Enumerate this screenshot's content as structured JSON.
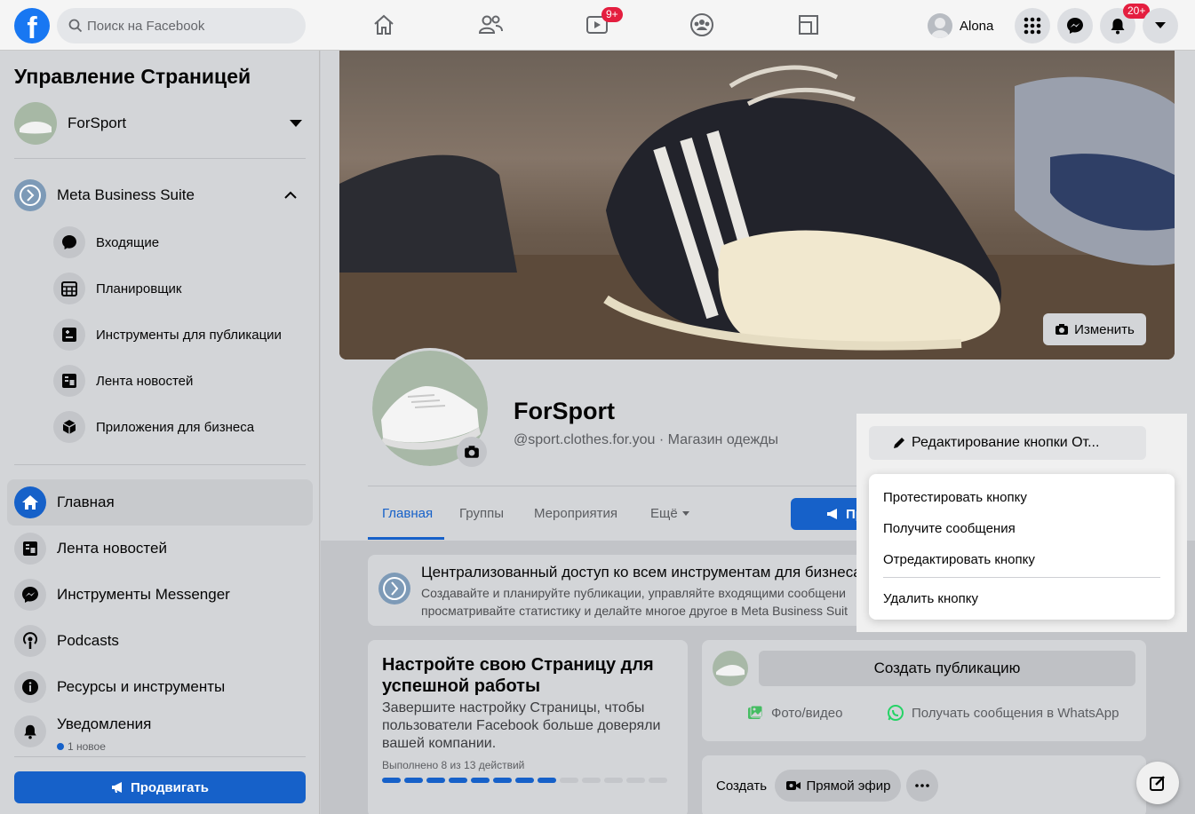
{
  "topbar": {
    "logo_letter": "f",
    "search_placeholder": "Поиск на Facebook",
    "watch_badge": "9+",
    "user_name": "Alona",
    "notifications_badge": "20+"
  },
  "sidebar": {
    "title": "Управление Страницей",
    "page_name": "ForSport",
    "meta_business_suite": "Meta Business Suite",
    "sub_items": [
      {
        "label": "Входящие",
        "icon": "message-icon"
      },
      {
        "label": "Планировщик",
        "icon": "calendar-icon"
      },
      {
        "label": "Инструменты для публикации",
        "icon": "publishing-tools-icon"
      },
      {
        "label": "Лента новостей",
        "icon": "news-feed-icon"
      },
      {
        "label": "Приложения для бизнеса",
        "icon": "apps-icon"
      }
    ],
    "main_items": [
      {
        "label": "Главная",
        "icon": "home-icon"
      },
      {
        "label": "Лента новостей",
        "icon": "news-feed-icon"
      },
      {
        "label": "Инструменты Messenger",
        "icon": "messenger-icon"
      },
      {
        "label": "Podcasts",
        "icon": "podcast-icon"
      },
      {
        "label": "Ресурсы и инструменты",
        "icon": "info-icon"
      },
      {
        "label": "Уведомления",
        "icon": "bell-icon"
      }
    ],
    "notifications_sub": "1 новое",
    "promote_button": "Продвигать"
  },
  "profile": {
    "edit_cover": "Изменить",
    "name": "ForSport",
    "handle": "@sport.clothes.for.you · Магазин одежды",
    "tabs": [
      "Главная",
      "Группы",
      "Мероприятия",
      "Ещё"
    ],
    "promote_button": "Про"
  },
  "popup": {
    "edit_button": "Редактирование кнопки От...",
    "items": [
      "Протестировать кнопку",
      "Получите сообщения",
      "Отредактировать кнопку"
    ],
    "delete": "Удалить кнопку"
  },
  "mbs_card": {
    "title": "Централизованный доступ ко всем инструментам для бизнеса",
    "line1": "Создавайте и планируйте публикации, управляйте входящими сообщени",
    "line2": "просматривайте статистику и делайте многое другое в Meta Business Suit"
  },
  "setup_card": {
    "title": "Настройте свою Страницу для успешной работы",
    "text": "Завершите настройку Страницы, чтобы пользователи Facebook больше доверяли вашей компании.",
    "progress_text": "Выполнено 8 из 13 действий",
    "steps_done": 8,
    "steps_total": 13
  },
  "create_card": {
    "button": "Создать публикацию",
    "photo_video": "Фото/видео",
    "whatsapp": "Получать сообщения в WhatsApp"
  },
  "live_card": {
    "label": "Создать",
    "live": "Прямой эфир"
  },
  "colors": {
    "accent": "#1661c9",
    "badge": "#e41e3f"
  }
}
